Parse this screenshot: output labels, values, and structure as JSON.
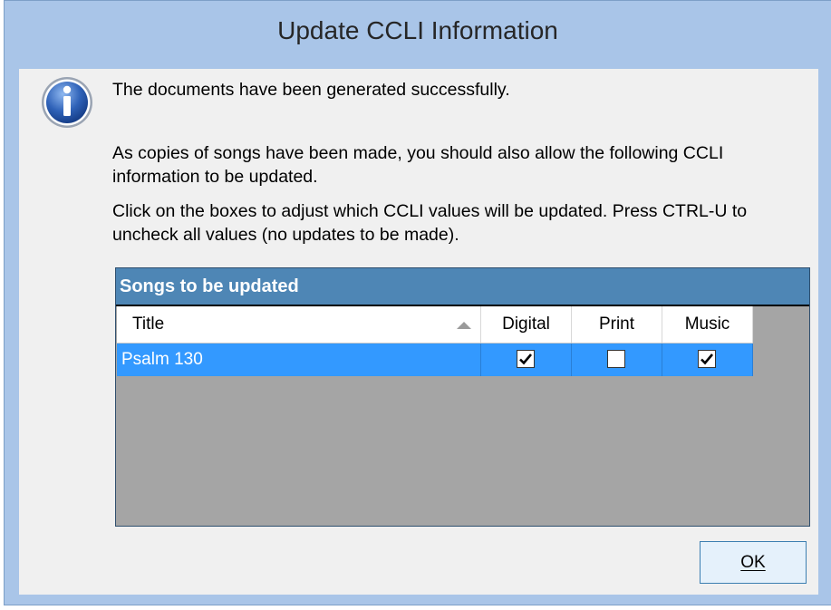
{
  "dialog": {
    "title": "Update CCLI Information",
    "icon": "info-icon",
    "message_success": "The documents have been generated successfully.",
    "message_copies": "As copies of songs have been made, you should also allow the following CCLI information to be updated.",
    "message_instructions": "Click on the boxes to adjust which CCLI values will be updated. Press CTRL-U to uncheck all values (no updates to be made).",
    "ok_label": "OK"
  },
  "songs_group": {
    "header": "Songs to be updated",
    "columns": {
      "title": "Title",
      "digital": "Digital",
      "print": "Print",
      "music": "Music"
    },
    "rows": [
      {
        "title": "Psalm 130",
        "digital": true,
        "print": false,
        "music": true,
        "selected": true
      }
    ]
  },
  "colors": {
    "title_bar": "#a9c5e8",
    "group_header": "#4e86b5",
    "selection": "#3399ff",
    "grid_background": "#a5a5a5"
  }
}
